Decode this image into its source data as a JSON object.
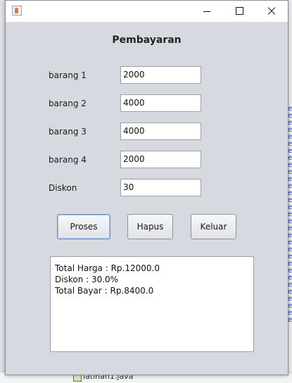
{
  "window": {
    "heading": "Pembayaran"
  },
  "form": {
    "rows": [
      {
        "label": "barang 1",
        "value": "2000"
      },
      {
        "label": "barang 2",
        "value": "4000"
      },
      {
        "label": "barang 3",
        "value": "4000"
      },
      {
        "label": "barang 4",
        "value": "2000"
      },
      {
        "label": "Diskon",
        "value": "30"
      }
    ]
  },
  "buttons": {
    "proses": "Proses",
    "hapus": "Hapus",
    "keluar": "Keluar"
  },
  "output": {
    "lines": [
      "Total Harga : Rp.12000.0",
      "Diskon : 30.0%",
      "Total Bayar : Rp.8400.0"
    ]
  },
  "background": {
    "file_name": "latihan1.java"
  },
  "colors": {
    "window_bg": "#d6d9df",
    "titlebar_bg": "#ffffff",
    "accent_focus": "#6c8fbf"
  },
  "icons": [
    "java-app-icon",
    "minimize-icon",
    "maximize-icon",
    "close-icon"
  ]
}
